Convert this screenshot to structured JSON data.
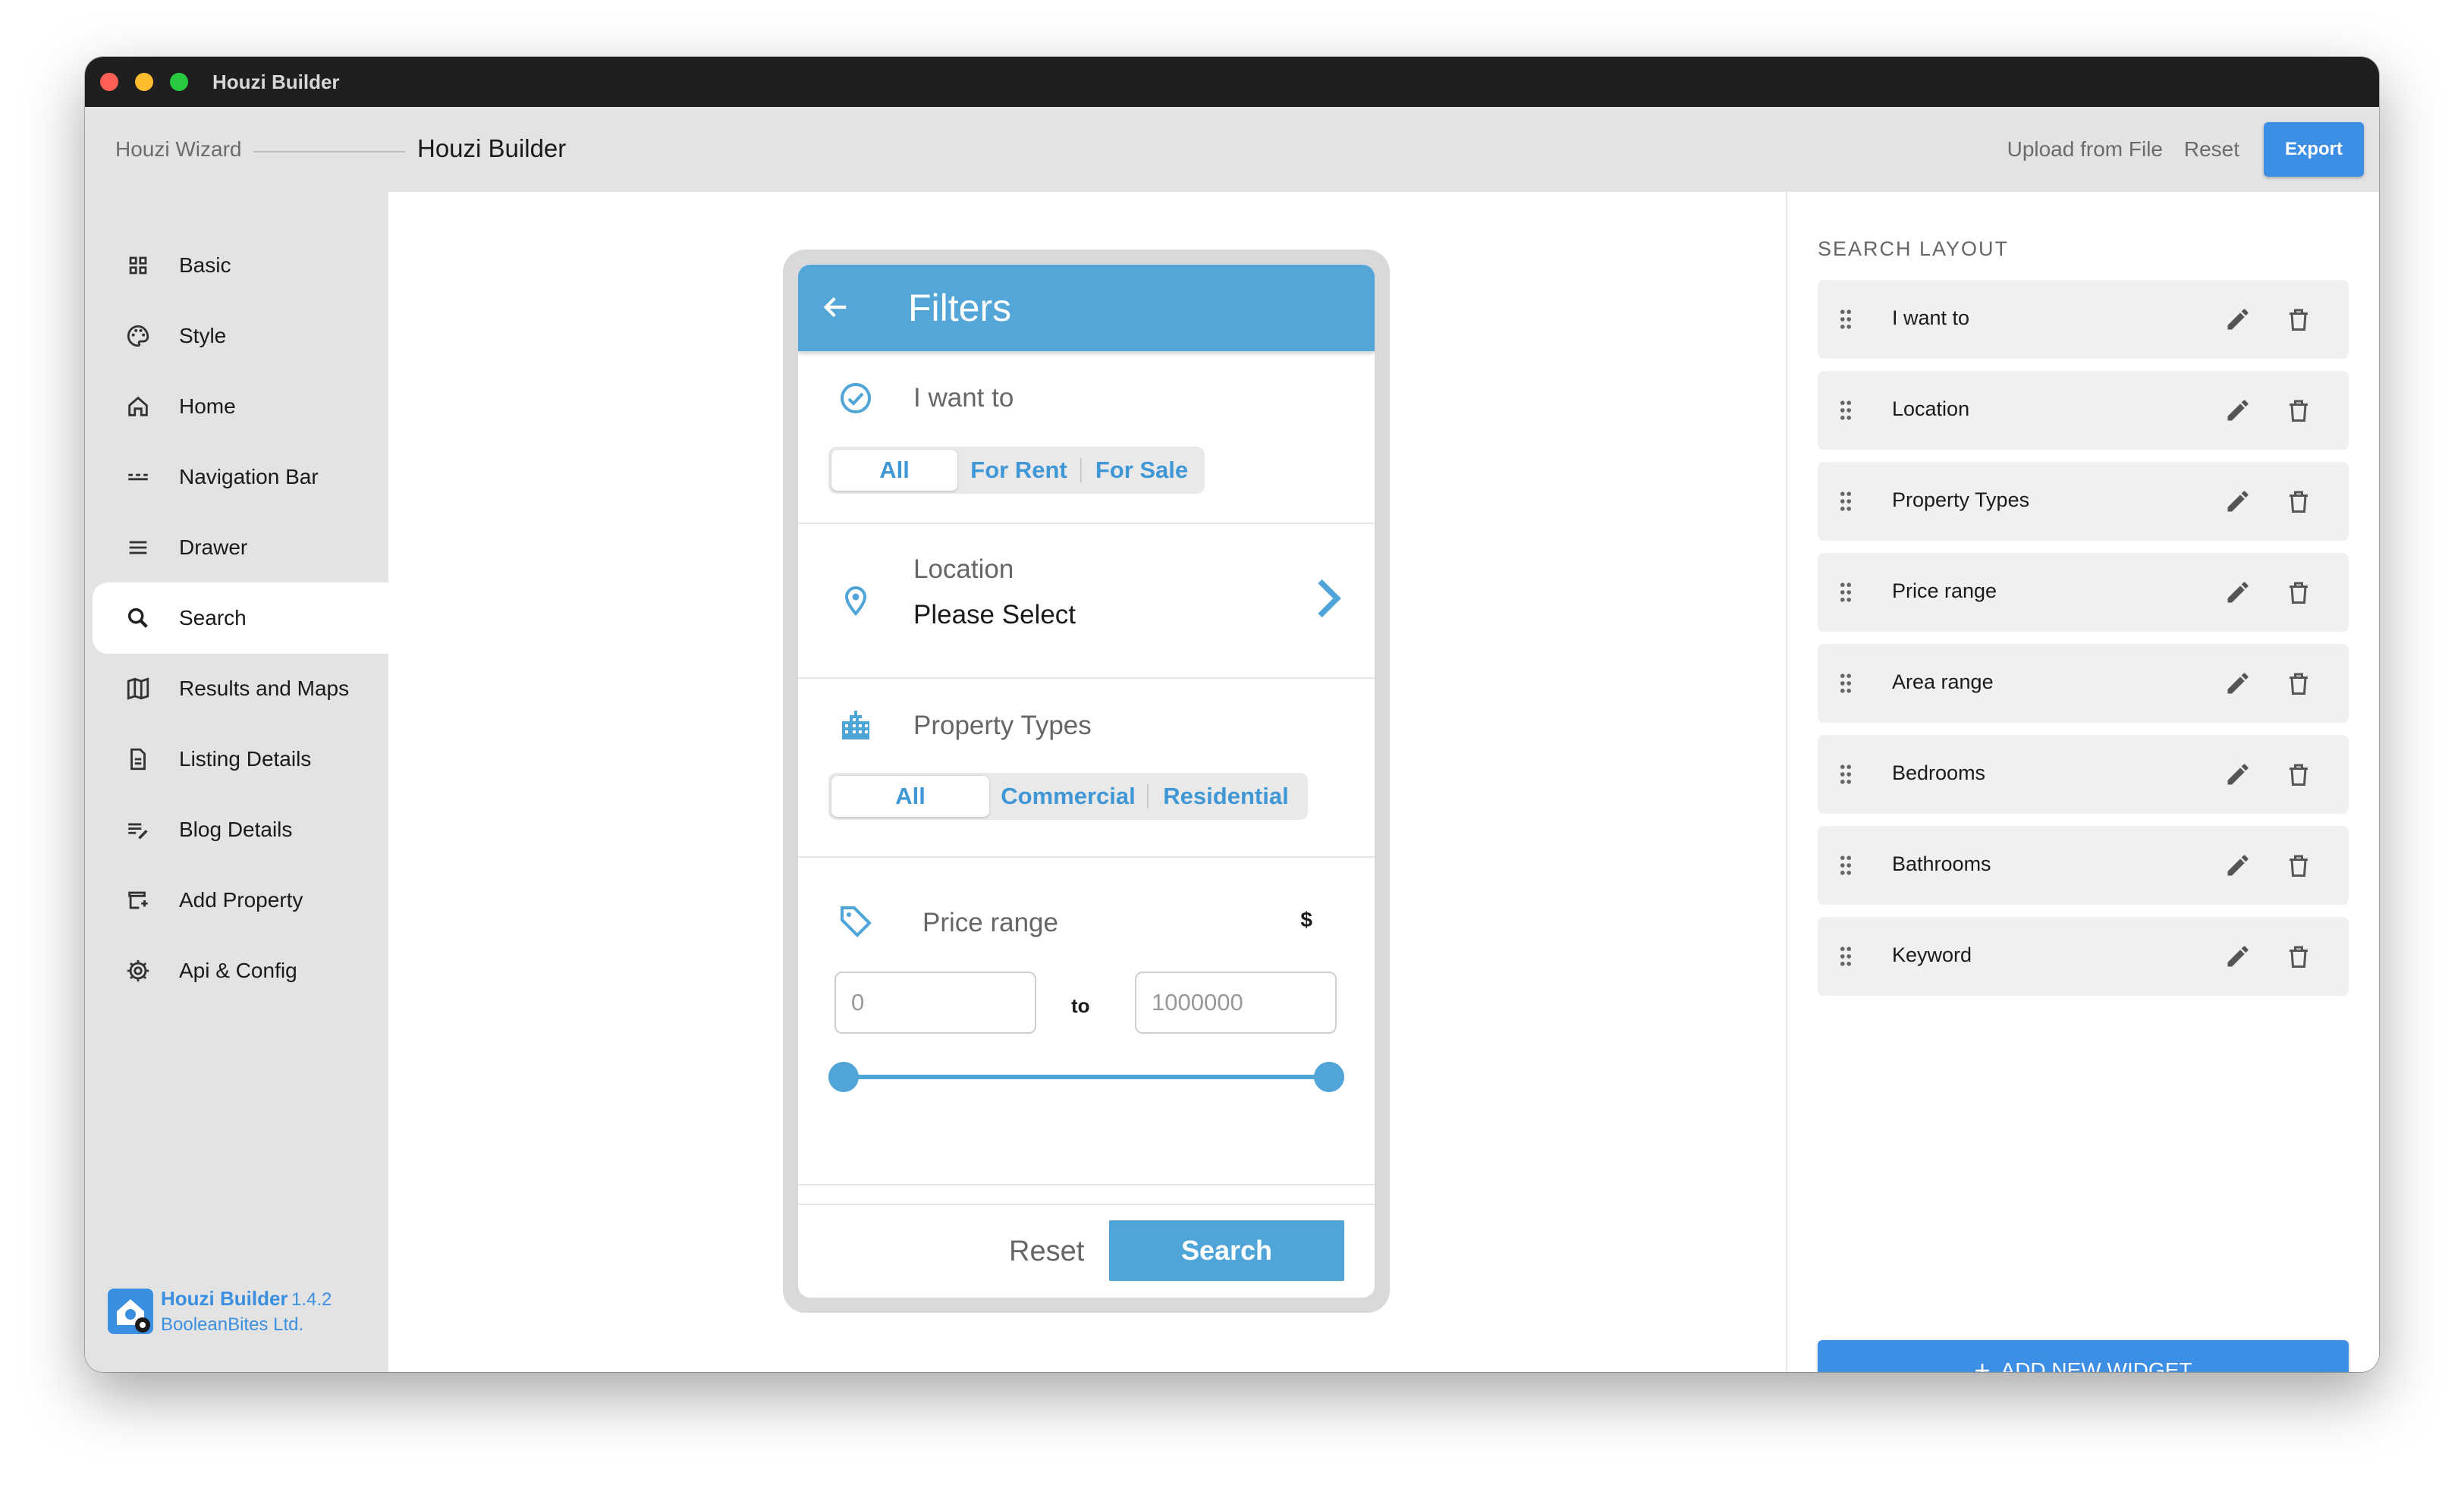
{
  "window": {
    "title": "Houzi Builder"
  },
  "appbar": {
    "breadcrumb_wizard": "Houzi Wizard",
    "breadcrumb_current": "Houzi Builder",
    "upload_label": "Upload from File",
    "reset_label": "Reset",
    "export_label": "Export"
  },
  "sidebar": {
    "items": [
      {
        "label": "Basic",
        "icon": "grid-icon"
      },
      {
        "label": "Style",
        "icon": "palette-icon"
      },
      {
        "label": "Home",
        "icon": "home-icon"
      },
      {
        "label": "Navigation Bar",
        "icon": "navigation-bar-icon"
      },
      {
        "label": "Drawer",
        "icon": "menu-icon"
      },
      {
        "label": "Search",
        "icon": "search-icon",
        "active": true
      },
      {
        "label": "Results and Maps",
        "icon": "map-icon"
      },
      {
        "label": "Listing Details",
        "icon": "document-icon"
      },
      {
        "label": "Blog Details",
        "icon": "edit-list-icon"
      },
      {
        "label": "Add Property",
        "icon": "add-property-icon"
      },
      {
        "label": "Api & Config",
        "icon": "gear-icon"
      }
    ],
    "brand": {
      "name": "Houzi Builder",
      "version": "1.4.2",
      "company": "BooleanBites Ltd."
    }
  },
  "phone": {
    "title": "Filters",
    "i_want_to": {
      "label": "I want to",
      "options": [
        "All",
        "For Rent",
        "For Sale"
      ],
      "selected": "All"
    },
    "location": {
      "label": "Location",
      "value": "Please Select"
    },
    "property_types": {
      "label": "Property Types",
      "options": [
        "All",
        "Commercial",
        "Residential"
      ],
      "selected": "All"
    },
    "price_range": {
      "label": "Price range",
      "currency": "$",
      "min_placeholder": "0",
      "max_placeholder": "1000000",
      "to_label": "to",
      "slider_min": 0,
      "slider_max": 1
    },
    "footer": {
      "reset_label": "Reset",
      "search_label": "Search"
    }
  },
  "search_layout": {
    "title": "SEARCH LAYOUT",
    "items": [
      "I want to",
      "Location",
      "Property Types",
      "Price range",
      "Area range",
      "Bedrooms",
      "Bathrooms",
      "Keyword"
    ],
    "add_label": "ADD NEW WIDGET"
  },
  "colors": {
    "accent": "#3d8fe6",
    "phone_primary": "#54a6d9",
    "sidebar_bg": "#e3e3e3"
  }
}
